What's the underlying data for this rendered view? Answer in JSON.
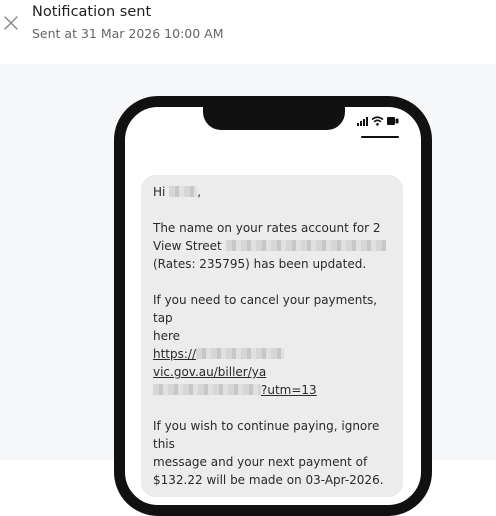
{
  "header": {
    "title": "Notification sent",
    "subtitle": "Sent at 31 Mar 2026 10:00 AM",
    "close_icon": "close-icon"
  },
  "phone": {
    "status_icons": [
      "signal-icon",
      "wifi-icon",
      "battery-icon"
    ]
  },
  "message": {
    "greeting_prefix": "Hi",
    "greeting_suffix": ",",
    "p1_line1": "The name on your rates account for 2",
    "p1_line2_prefix": "View Street",
    "p1_line3": "(Rates: 235795) has been updated.",
    "p2_line1": "If you need to cancel your payments, tap",
    "p2_line2": "here",
    "link_part1_prefix": "https://",
    "link_part1_suffix": "vic.gov.au/biller/ya",
    "link_part2_suffix": "?utm=13",
    "p3_line1": "If you wish to continue paying, ignore this",
    "p3_line2": "message and your next payment of",
    "p3_line3": "$132.22 will be made on 03-Apr-2026."
  }
}
